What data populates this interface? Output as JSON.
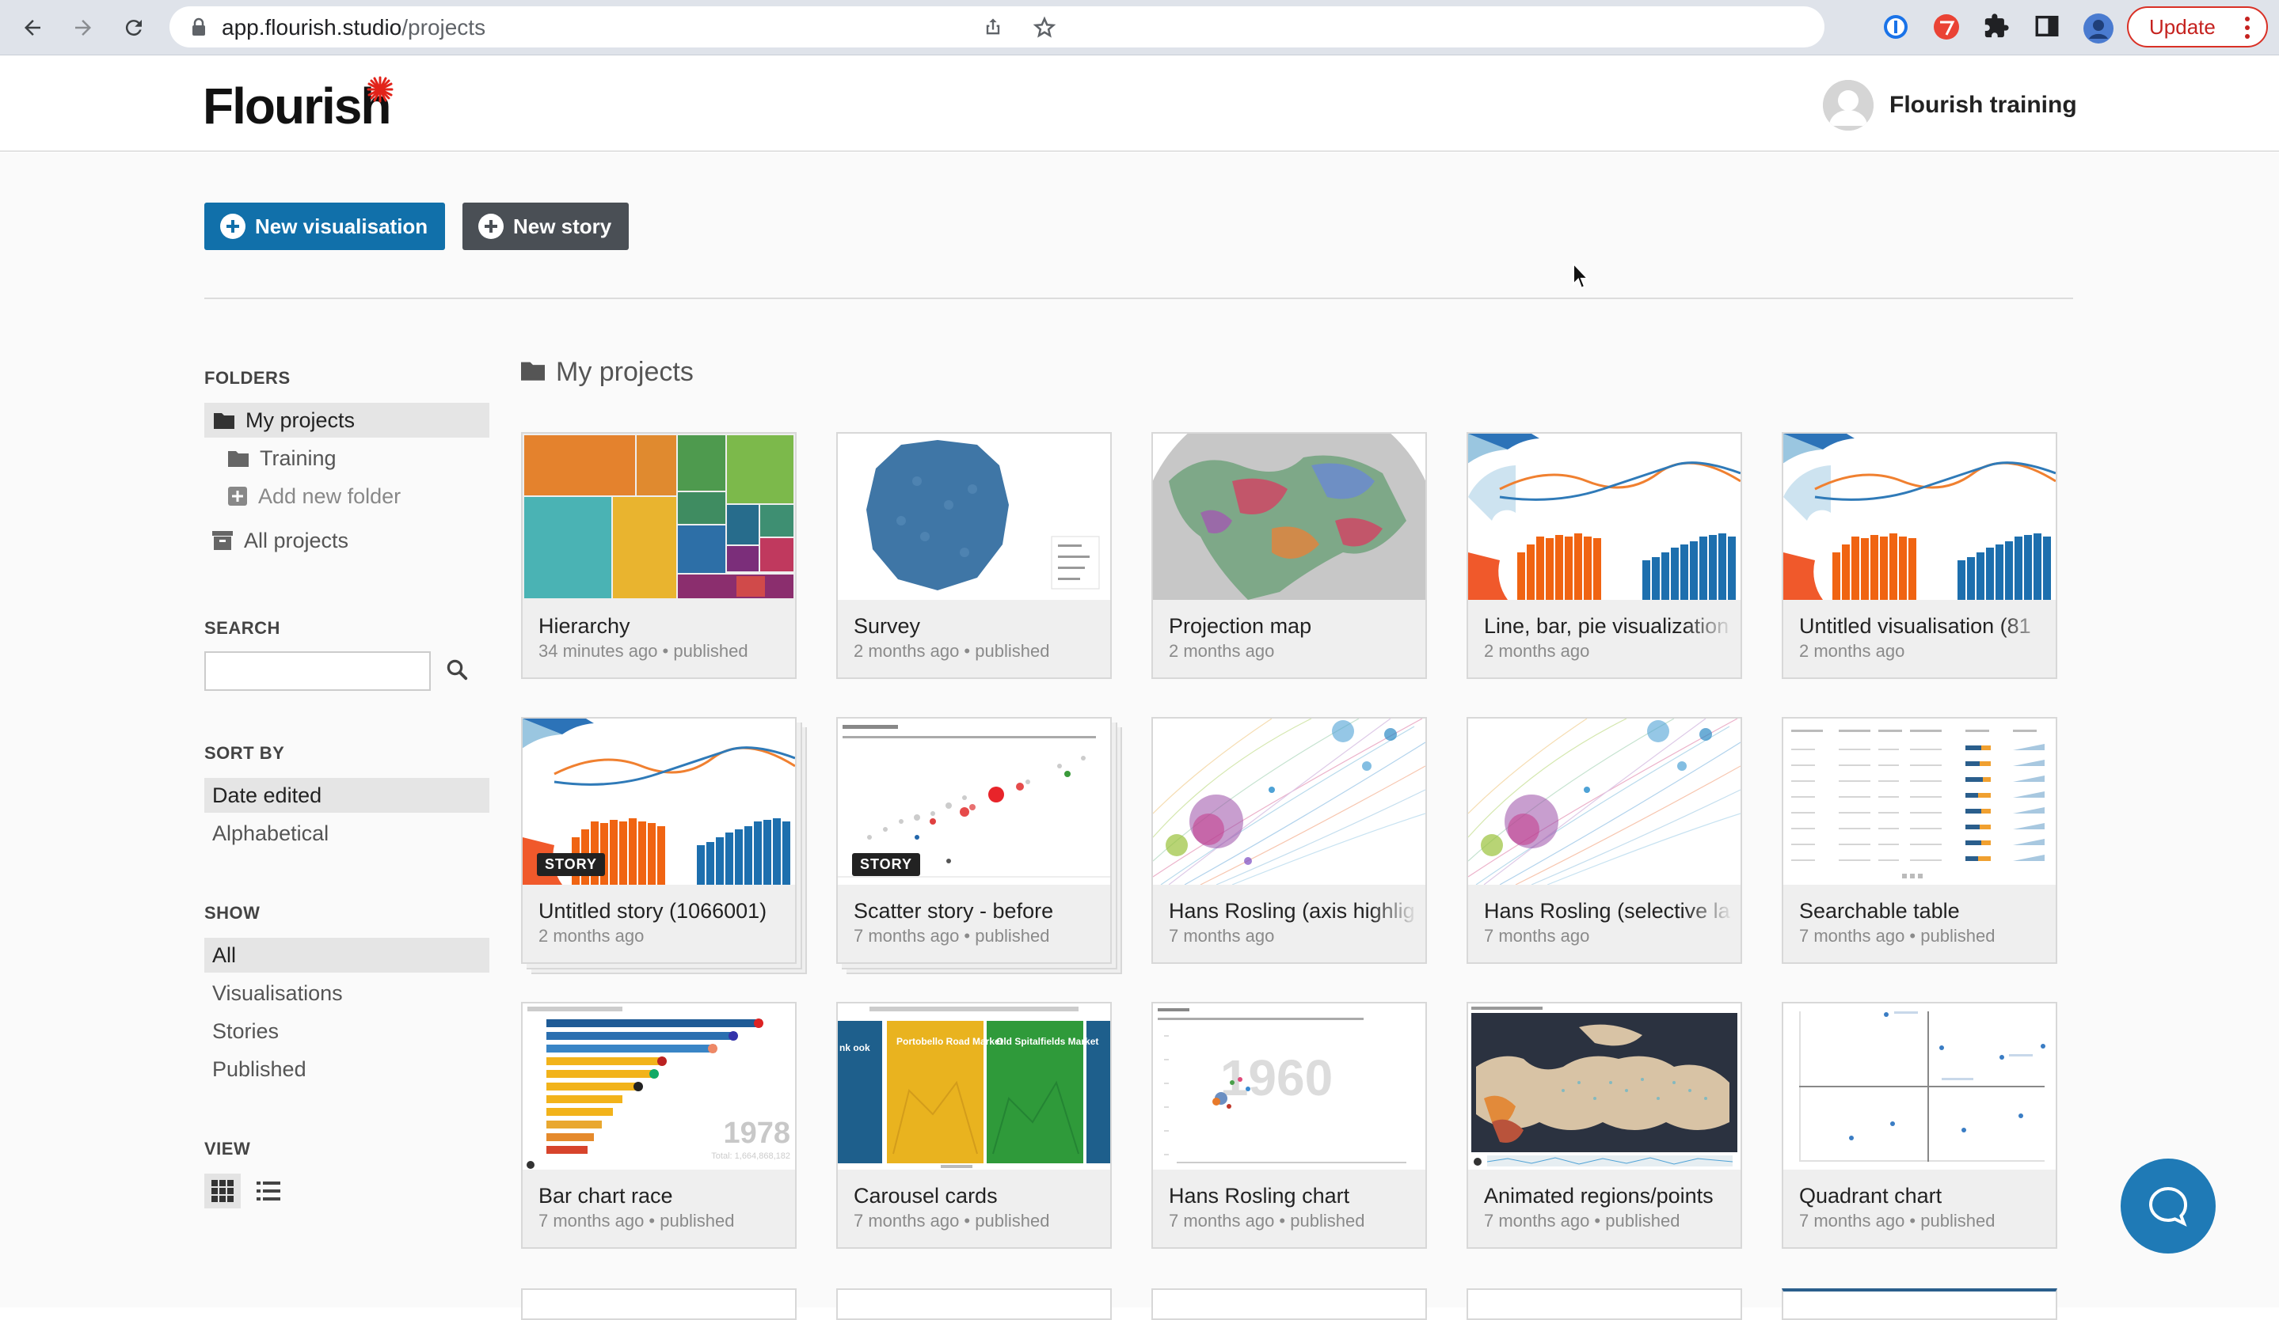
{
  "browser": {
    "url_host": "app.flourish.studio",
    "url_path": "/projects",
    "update_label": "Update"
  },
  "header": {
    "logo_text": "Flourish",
    "user_name": "Flourish training"
  },
  "actions": {
    "new_visualisation": "New visualisation",
    "new_story": "New story"
  },
  "sidebar": {
    "folders_heading": "FOLDERS",
    "folders": [
      {
        "label": "My projects",
        "active": true
      },
      {
        "label": "Training",
        "active": false
      },
      {
        "label": "Add new folder",
        "active": false
      },
      {
        "label": "All projects",
        "active": false
      }
    ],
    "search_heading": "SEARCH",
    "search_placeholder": "",
    "sort_heading": "SORT BY",
    "sort_options": [
      {
        "label": "Date edited",
        "active": true
      },
      {
        "label": "Alphabetical",
        "active": false
      }
    ],
    "show_heading": "SHOW",
    "show_options": [
      {
        "label": "All",
        "active": true
      },
      {
        "label": "Visualisations",
        "active": false
      },
      {
        "label": "Stories",
        "active": false
      },
      {
        "label": "Published",
        "active": false
      }
    ],
    "view_heading": "VIEW",
    "view_modes": [
      "grid-icon",
      "list-icon"
    ]
  },
  "projects_heading": "My projects",
  "cards": [
    {
      "title": "Hierarchy",
      "meta": "34 minutes ago • published",
      "thumb": "treemap"
    },
    {
      "title": "Survey",
      "meta": "2 months ago • published",
      "thumb": "survey"
    },
    {
      "title": "Projection map",
      "meta": "2 months ago",
      "thumb": "map"
    },
    {
      "title": "Line, bar, pie visualization",
      "meta": "2 months ago",
      "thumb": "linebarpie"
    },
    {
      "title": "Untitled visualisation (81",
      "meta": "2 months ago",
      "thumb": "linebarpie"
    },
    {
      "title": "Untitled story (1066001)",
      "meta": "2 months ago",
      "thumb": "linebarpie",
      "story": true
    },
    {
      "title": "Scatter story - before",
      "meta": "7 months ago • published",
      "thumb": "scatter",
      "story": true
    },
    {
      "title": "Hans Rosling (axis highlig",
      "meta": "7 months ago",
      "thumb": "rosling"
    },
    {
      "title": "Hans Rosling (selective la",
      "meta": "7 months ago",
      "thumb": "rosling"
    },
    {
      "title": "Searchable table",
      "meta": "7 months ago • published",
      "thumb": "table"
    },
    {
      "title": "Bar chart race",
      "meta": "7 months ago • published",
      "thumb": "barrace"
    },
    {
      "title": "Carousel cards",
      "meta": "7 months ago • published",
      "thumb": "carousel"
    },
    {
      "title": "Hans Rosling chart",
      "meta": "7 months ago • published",
      "thumb": "rosling1960"
    },
    {
      "title": "Animated regions/points",
      "meta": "7 months ago • published",
      "thumb": "darkmap"
    },
    {
      "title": "Quadrant chart",
      "meta": "7 months ago • published",
      "thumb": "quadrant"
    }
  ],
  "story_badge": "STORY",
  "thumb_text": {
    "barrace_year": "1978",
    "barrace_total": "Total: 1,664,868,182",
    "rosling_year": "1960",
    "carousel_card1": "Portobello Road Market",
    "carousel_card2": "Old Spitalfields Market",
    "carousel_left": "nk ook"
  },
  "colors": {
    "primary": "#1170aa",
    "story_button": "#4a4f55",
    "logo_star": "#e2231a",
    "update": "#c5221f"
  }
}
